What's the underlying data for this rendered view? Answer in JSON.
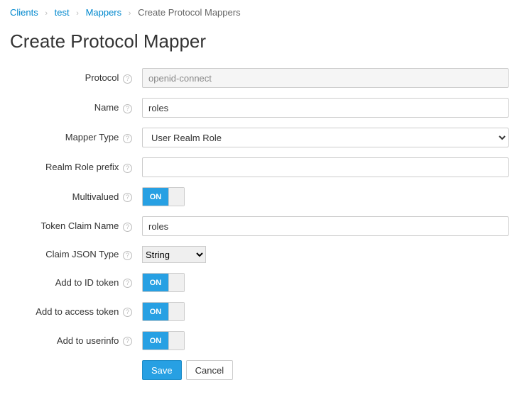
{
  "breadcrumb": {
    "items": [
      {
        "label": "Clients",
        "link": true
      },
      {
        "label": "test",
        "link": true
      },
      {
        "label": "Mappers",
        "link": true
      },
      {
        "label": "Create Protocol Mappers",
        "link": false
      }
    ],
    "chevron": "›"
  },
  "title": "Create Protocol Mapper",
  "labels": {
    "protocol": "Protocol",
    "name": "Name",
    "mapperType": "Mapper Type",
    "realmRolePrefix": "Realm Role prefix",
    "multivalued": "Multivalued",
    "tokenClaimName": "Token Claim Name",
    "claimJsonType": "Claim JSON Type",
    "addToIdToken": "Add to ID token",
    "addToAccessToken": "Add to access token",
    "addToUserinfo": "Add to userinfo"
  },
  "values": {
    "protocol": "openid-connect",
    "name": "roles",
    "mapperType": "User Realm Role",
    "realmRolePrefix": "",
    "tokenClaimName": "roles",
    "claimJsonType": "String"
  },
  "toggle": {
    "on": "ON"
  },
  "buttons": {
    "save": "Save",
    "cancel": "Cancel"
  }
}
